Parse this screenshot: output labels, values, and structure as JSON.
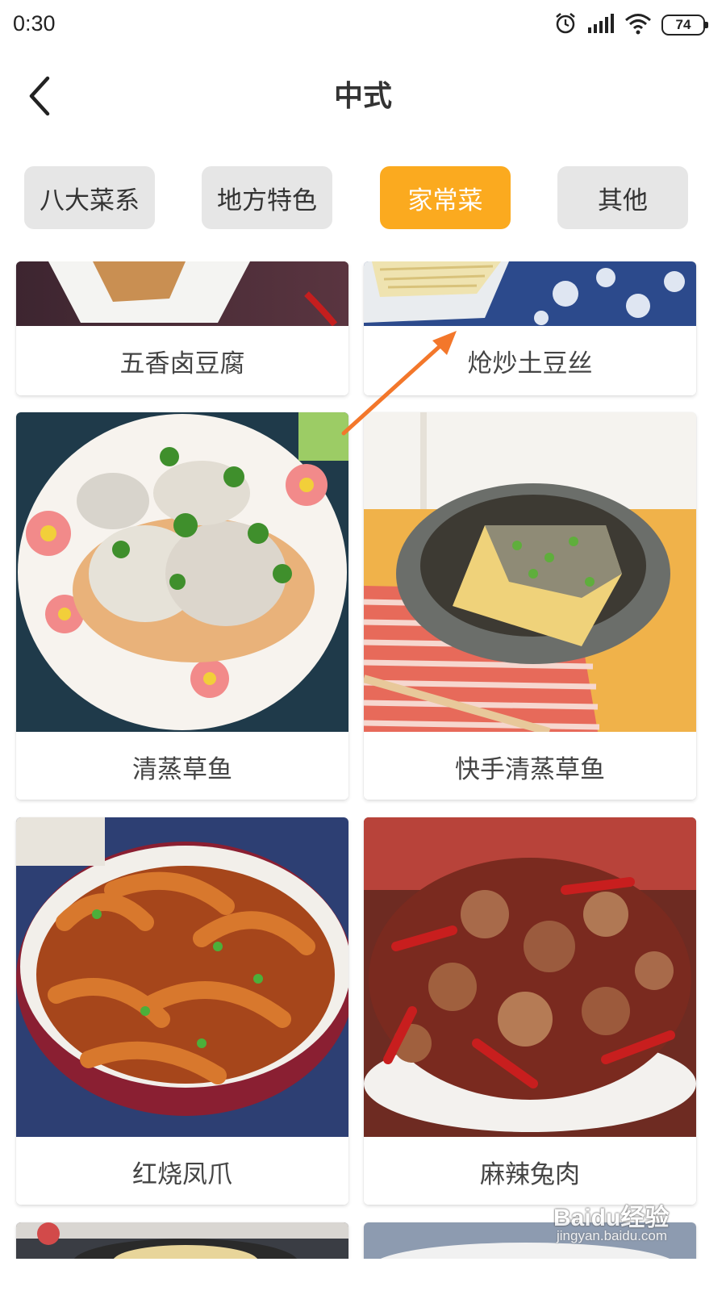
{
  "status_bar": {
    "time": "0:30",
    "battery": "74",
    "icons": [
      "alarm-icon",
      "signal-icon",
      "wifi-icon",
      "battery-icon"
    ]
  },
  "header": {
    "title": "中式",
    "back_icon": "chevron-left-icon"
  },
  "tabs": [
    {
      "label": "八大菜系",
      "active": false
    },
    {
      "label": "地方特色",
      "active": false
    },
    {
      "label": "家常菜",
      "active": true
    },
    {
      "label": "其他",
      "active": false
    }
  ],
  "recipes": [
    {
      "name": "五香卤豆腐"
    },
    {
      "name": "炝炒土豆丝"
    },
    {
      "name": "清蒸草鱼"
    },
    {
      "name": "快手清蒸草鱼"
    },
    {
      "name": "红烧凤爪"
    },
    {
      "name": "麻辣兔肉"
    }
  ],
  "annotation": {
    "arrow_color": "#f3772b"
  },
  "watermark": {
    "logo": "Baidu经验",
    "url": "jingyan.baidu.com"
  },
  "colors": {
    "accent": "#fbaa1f",
    "tab_inactive": "#e6e6e6"
  }
}
